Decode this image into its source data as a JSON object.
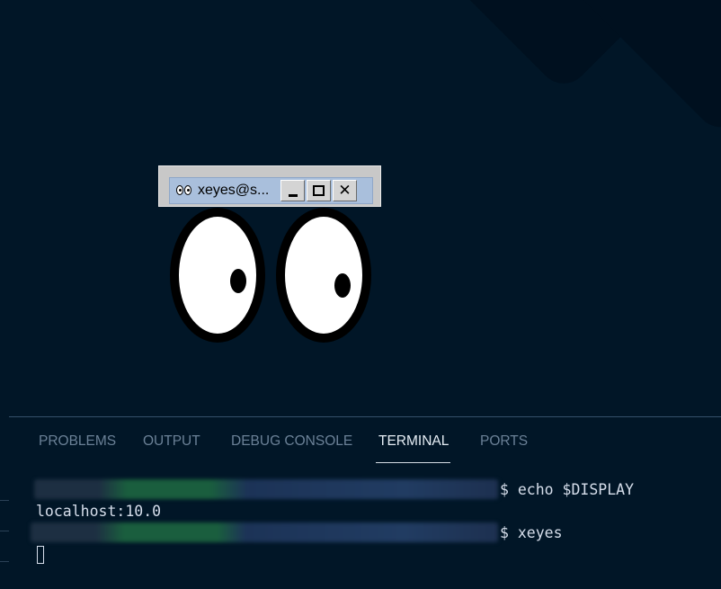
{
  "xeyes_window": {
    "title": "xeyes@s...",
    "minimize_label": "",
    "maximize_label": "",
    "close_label": "✕"
  },
  "panel": {
    "tabs": [
      {
        "label": "PROBLEMS",
        "active": false
      },
      {
        "label": "OUTPUT",
        "active": false
      },
      {
        "label": "DEBUG CONSOLE",
        "active": false
      },
      {
        "label": "TERMINAL",
        "active": true
      },
      {
        "label": "PORTS",
        "active": false
      }
    ]
  },
  "terminal": {
    "lines": [
      {
        "command": "$ echo $DISPLAY"
      },
      {
        "output": "localhost:10.0"
      },
      {
        "command": "$ xeyes"
      }
    ]
  },
  "colors": {
    "background": "#011627",
    "terminal_text": "#d6deeb",
    "tab_inactive": "#6b8197",
    "tab_active": "#e6eef5"
  }
}
